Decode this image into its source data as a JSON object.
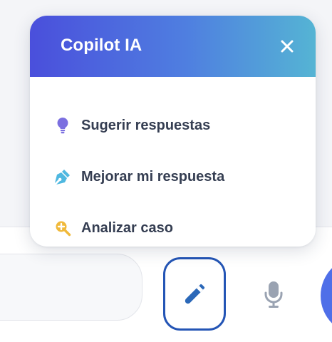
{
  "popup": {
    "title": "Copilot IA",
    "items": [
      {
        "label": "Sugerir respuestas",
        "icon": "lightbulb-icon"
      },
      {
        "label": "Mejorar mi respuesta",
        "icon": "pen-nib-icon"
      },
      {
        "label": "Analizar caso",
        "icon": "search-plus-icon"
      }
    ]
  },
  "colors": {
    "header_gradient_start": "#4a4fdc",
    "header_gradient_end": "#55b4d4",
    "lightbulb": "#7b6fe0",
    "pen_nib": "#4fb8e0",
    "search": "#f0b93a",
    "copilot_border": "#2455b5",
    "send_button": "#4f6fe8",
    "mic": "#9aa3b2"
  },
  "footer": {
    "icons": [
      "magic-wand-icon",
      "microphone-icon"
    ]
  }
}
